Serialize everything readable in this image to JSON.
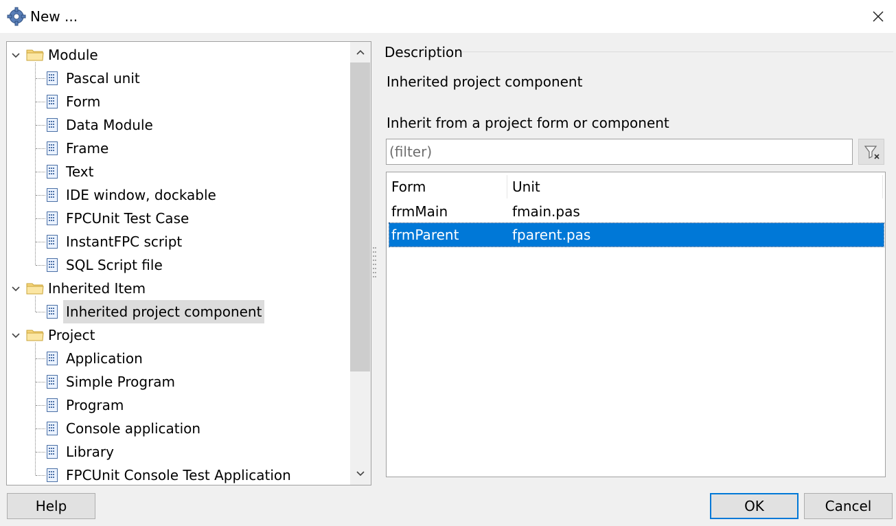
{
  "window": {
    "title": "New ...",
    "app_icon": "gear-icon",
    "close_icon": "close-icon"
  },
  "tree": {
    "groups": [
      {
        "label": "Module",
        "items": [
          "Pascal unit",
          "Form",
          "Data Module",
          "Frame",
          "Text",
          "IDE window, dockable",
          "FPCUnit Test Case",
          "InstantFPC script",
          "SQL Script file"
        ]
      },
      {
        "label": "Inherited Item",
        "items": [
          "Inherited project component"
        ]
      },
      {
        "label": "Project",
        "items": [
          "Application",
          "Simple Program",
          "Program",
          "Console application",
          "Library",
          "FPCUnit Console Test Application"
        ]
      }
    ],
    "selected_item": "Inherited project component"
  },
  "description": {
    "group_label": "Description",
    "text": "Inherited project component",
    "inherit_label": "Inherit from a project form or component",
    "filter_placeholder": "(filter)",
    "filter_icon": "filter-clear-icon"
  },
  "list": {
    "columns": [
      "Form",
      "Unit"
    ],
    "rows": [
      {
        "form": "frmMain",
        "unit": "fmain.pas"
      },
      {
        "form": "frmParent",
        "unit": "fparent.pas"
      }
    ],
    "selected_row": 1
  },
  "buttons": {
    "help": "Help",
    "ok": "OK",
    "cancel": "Cancel"
  },
  "colors": {
    "selection": "#0078d7",
    "tree_selection": "#dcdcdc"
  }
}
